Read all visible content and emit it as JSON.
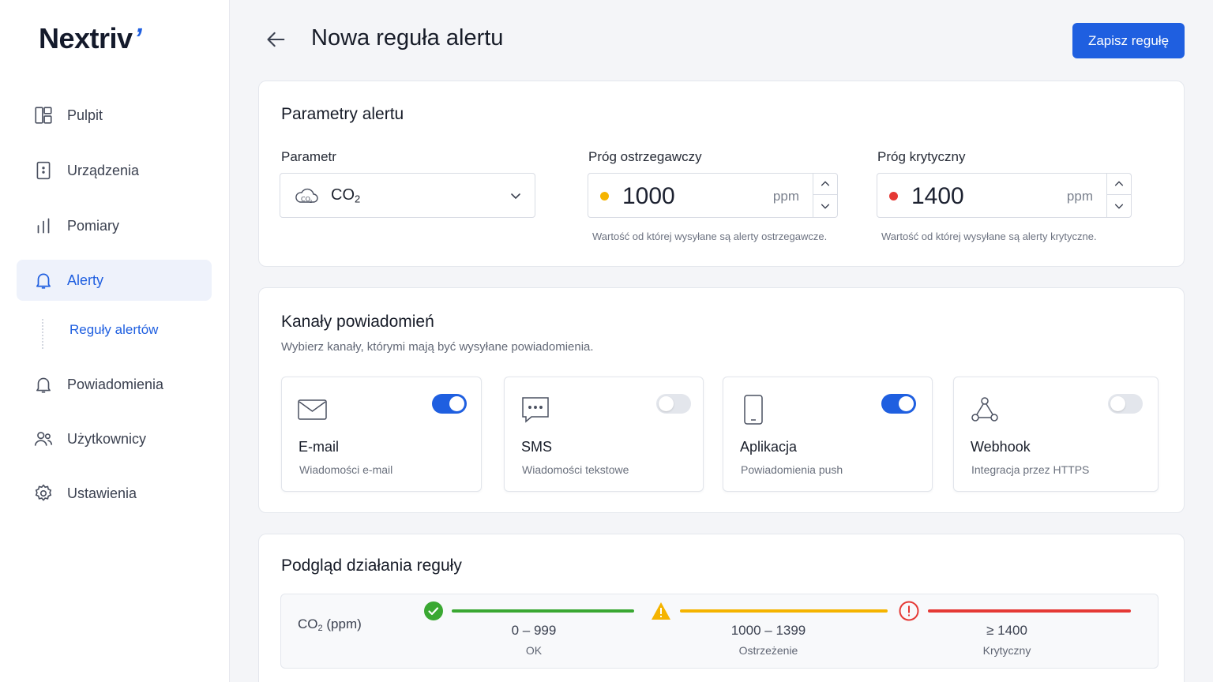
{
  "sidebar": {
    "logo": "Nextriv",
    "items": [
      {
        "label": "Pulpit",
        "icon": "dashboard-icon"
      },
      {
        "label": "Urządzenia",
        "icon": "device-icon"
      },
      {
        "label": "Pomiary",
        "icon": "bar-chart-icon"
      },
      {
        "label": "Alerty",
        "icon": "bell-icon",
        "active": true
      },
      {
        "label": "Powiadomienia",
        "icon": "bell-icon"
      },
      {
        "label": "Użytkownicy",
        "icon": "users-icon"
      },
      {
        "label": "Ustawienia",
        "icon": "gear-icon"
      }
    ],
    "sub_item": "Reguły alertów"
  },
  "header": {
    "title": "Nowa reguła alertu",
    "save_label": "Zapisz regułę"
  },
  "params": {
    "title": "Parametry alertu",
    "parameter_label": "Parametr",
    "parameter_value": "CO",
    "parameter_sub": "2",
    "warning_label": "Próg ostrzegawczy",
    "warning_value": "1000",
    "warning_unit": "ppm",
    "warning_hint": "Wartość od której wysyłane są alerty ostrzegawcze.",
    "critical_label": "Próg krytyczny",
    "critical_value": "1400",
    "critical_unit": "ppm",
    "critical_hint": "Wartość od której wysyłane są alerty krytyczne.",
    "colors": {
      "warning": "#f5b400",
      "critical": "#e53935"
    }
  },
  "channels": {
    "title": "Kanały powiadomień",
    "subtitle": "Wybierz kanały, którymi mają być wysyłane powiadomienia.",
    "items": [
      {
        "name": "E-mail",
        "desc": "Wiadomości e-mail",
        "icon": "mail-icon",
        "enabled": true
      },
      {
        "name": "SMS",
        "desc": "Wiadomości tekstowe",
        "icon": "message-icon",
        "enabled": false
      },
      {
        "name": "Aplikacja",
        "desc": "Powiadomienia push",
        "icon": "smartphone-icon",
        "enabled": true
      },
      {
        "name": "Webhook",
        "desc": "Integracja przez HTTPS",
        "icon": "webhook-icon",
        "enabled": false
      }
    ]
  },
  "preview": {
    "title": "Podgląd działania reguły",
    "label_main": "CO",
    "label_sub": "2",
    "label_unit": "(ppm)",
    "segments": [
      {
        "range": "0 – 999",
        "name": "OK",
        "color": "#3aa832",
        "icon": "check-circle-icon"
      },
      {
        "range": "1000 – 1399",
        "name": "Ostrzeżenie",
        "color": "#f5b400",
        "icon": "warning-triangle-icon"
      },
      {
        "range": "≥ 1400",
        "name": "Krytyczny",
        "color": "#e53935",
        "icon": "alert-circle-icon"
      }
    ]
  }
}
